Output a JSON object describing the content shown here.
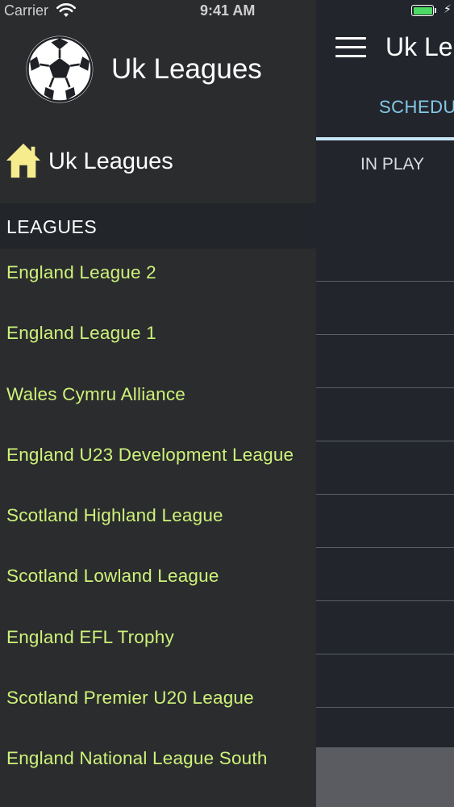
{
  "status_bar": {
    "carrier": "Carrier",
    "time": "9:41 AM",
    "battery_color": "#4cd964"
  },
  "main": {
    "nav_title": "Uk Leagues",
    "menu_icon": "hamburger-menu-icon",
    "tab_label": "SCHEDULE",
    "subtab_label": "IN PLAY",
    "tab_color": "#86c8e8"
  },
  "drawer": {
    "app_icon": "soccer-ball-icon",
    "app_title": "Uk Leagues",
    "home_icon": "home-icon",
    "home_label": "Uk Leagues",
    "section_label": "LEAGUES",
    "league_color": "#cdf27a",
    "leagues": [
      "England League 2",
      "England League 1",
      "Wales Cymru Alliance",
      "England U23 Development League",
      "Scotland Highland League",
      "Scotland Lowland League",
      "England EFL Trophy",
      "Scotland Premier U20 League",
      "England National League South"
    ]
  }
}
